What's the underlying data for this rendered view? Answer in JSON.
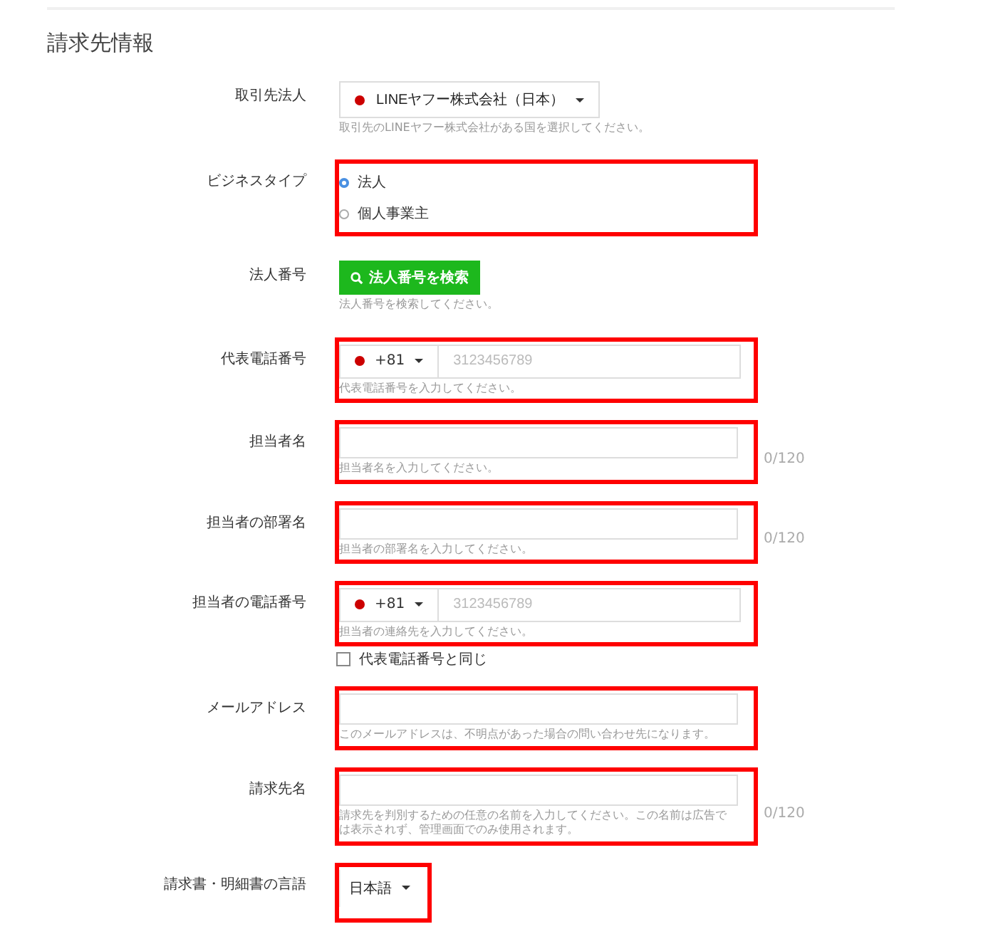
{
  "section_title": "請求先情報",
  "fields": [
    {
      "kind": "country-select",
      "label": "取引先法人",
      "value": "LINEヤフー株式会社（日本）",
      "help": "取引先のLINEヤフー株式会社がある国を選択してください。",
      "highlighted": false
    },
    {
      "kind": "radio",
      "label": "ビジネスタイプ",
      "options": [
        {
          "label": "法人",
          "selected": true
        },
        {
          "label": "個人事業主",
          "selected": false
        }
      ],
      "highlighted": true
    },
    {
      "kind": "button",
      "label": "法人番号",
      "button": "法人番号を検索",
      "help": "法人番号を検索してください。",
      "highlighted": false
    },
    {
      "kind": "phone",
      "label": "代表電話番号",
      "code": "+81",
      "placeholder": "3123456789",
      "help": "代表電話番号を入力してください。",
      "highlighted": true
    },
    {
      "kind": "text",
      "label": "担当者名",
      "counter": "0/120",
      "help": "担当者名を入力してください。",
      "highlighted": true
    },
    {
      "kind": "text",
      "label": "担当者の部署名",
      "counter": "0/120",
      "help": "担当者の部署名を入力してください。",
      "highlighted": true
    },
    {
      "kind": "phone",
      "label": "担当者の電話番号",
      "code": "+81",
      "placeholder": "3123456789",
      "help": "担当者の連絡先を入力してください。",
      "checkbox": {
        "label": "代表電話番号と同じ",
        "checked": false
      },
      "highlighted": true
    },
    {
      "kind": "text",
      "label": "メールアドレス",
      "help": "このメールアドレスは、不明点があった場合の問い合わせ先になります。",
      "highlighted": true
    },
    {
      "kind": "text",
      "label": "請求先名",
      "counter": "0/120",
      "help": "請求先を判別するための任意の名前を入力してください。この名前は広告では表示されず、管理画面でのみ使用されます。",
      "highlighted": true
    },
    {
      "kind": "dropdown",
      "label": "請求書・明細書の言語",
      "value": "日本語",
      "highlighted": true
    }
  ]
}
